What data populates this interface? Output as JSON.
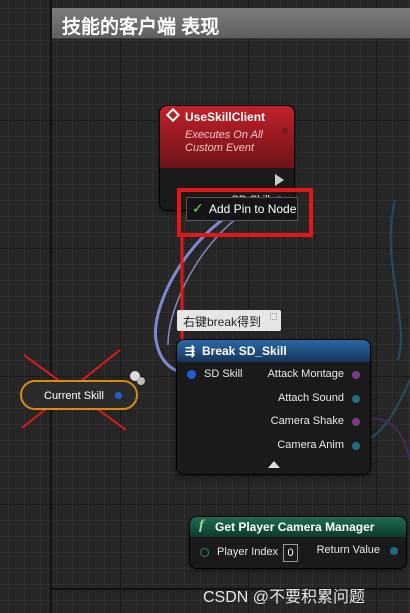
{
  "window": {
    "title": "技能的客户端 表现"
  },
  "event_node": {
    "title": "UseSkillClient",
    "subtitle_line1": "Executes On All",
    "subtitle_line2": "Custom Event",
    "output_pin": "SD Skill"
  },
  "context_menu": {
    "item": "Add Pin to Node"
  },
  "comment_note": "右键break得到",
  "break_node": {
    "title": "Break SD_Skill",
    "input_pin": "SD Skill",
    "outputs": [
      "Attack Montage",
      "Attach Sound",
      "Camera Shake",
      "Camera Anim"
    ]
  },
  "variable_node": {
    "label": "Current Skill"
  },
  "camera_node": {
    "title": "Get Player Camera Manager",
    "input_label": "Player Index",
    "input_value": "0",
    "output_label": "Return Value"
  },
  "watermark": "CSDN @不要积累问题",
  "colors": {
    "event_header": "#c1212a",
    "break_header": "#2c66a6",
    "function_header": "#1d6b52",
    "annotation_red": "#e01818",
    "variable_outline": "#d98a14"
  }
}
